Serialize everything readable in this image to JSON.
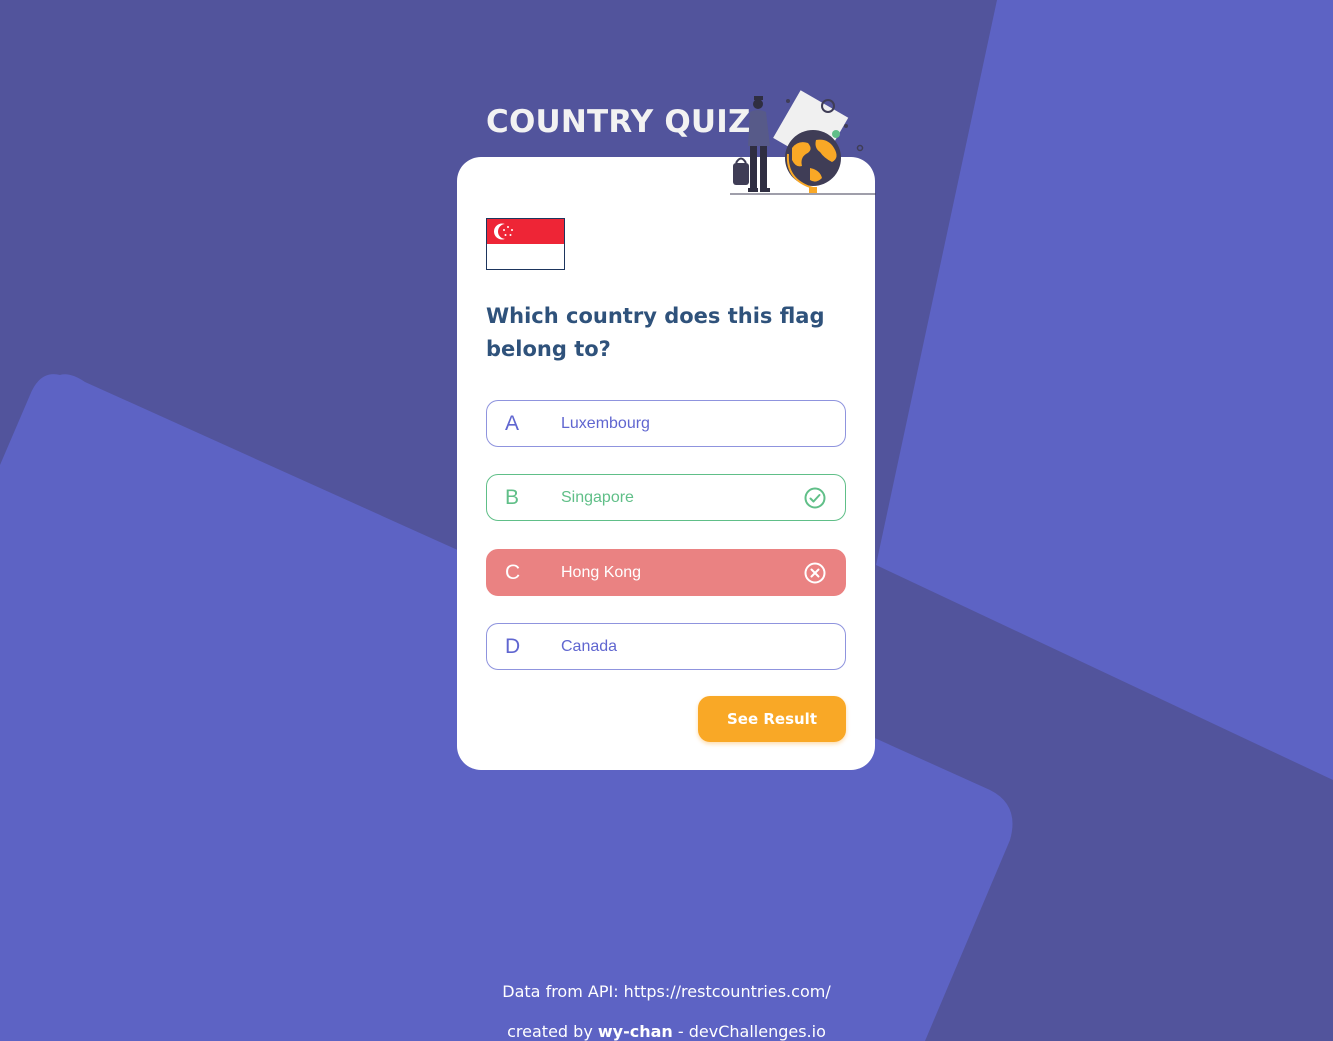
{
  "app": {
    "title": "COUNTRY QUIZ"
  },
  "quiz": {
    "flag_country": "Singapore",
    "question": "Which country does this flag belong to?",
    "options": [
      {
        "letter": "A",
        "text": "Luxembourg",
        "state": "default"
      },
      {
        "letter": "B",
        "text": "Singapore",
        "state": "correct"
      },
      {
        "letter": "C",
        "text": "Hong Kong",
        "state": "wrong"
      },
      {
        "letter": "D",
        "text": "Canada",
        "state": "default"
      }
    ],
    "see_result_label": "See Result"
  },
  "footer": {
    "api_text": "Data from API: https://restcountries.com/",
    "created_prefix": "created by",
    "author": "wy-chan",
    "suffix": "- devChallenges.io"
  },
  "colors": {
    "background": "#52549c",
    "background_shape": "#5d63c4",
    "title": "#f2f2f2",
    "question": "#2f527b",
    "option": "#6066d0",
    "correct": "#60bf88",
    "wrong": "#ea8282",
    "button": "#f9a826",
    "flag_red": "#ee2536"
  },
  "icons": {
    "correct": "check-circle-icon",
    "wrong": "x-circle-icon"
  }
}
